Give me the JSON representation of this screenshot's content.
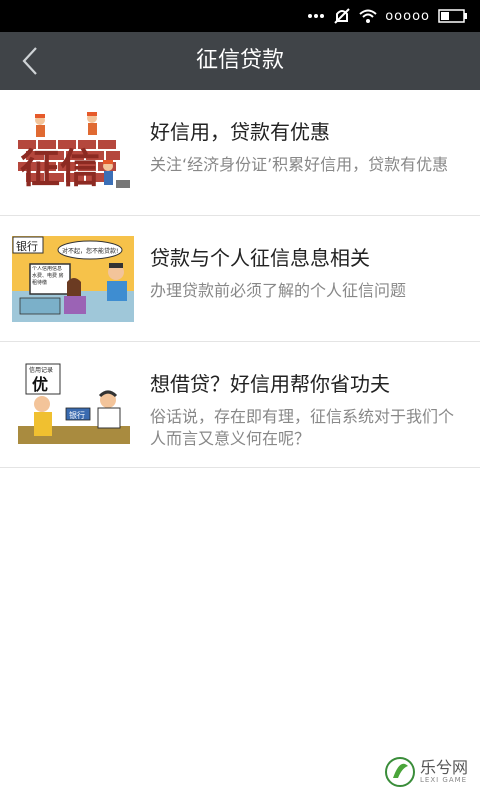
{
  "status_bar": {
    "carrier_dots": "ooooo",
    "icons": [
      "mute-icon",
      "wifi-icon",
      "signal-icon",
      "battery-icon"
    ]
  },
  "header": {
    "title": "征信贷款",
    "back_icon": "chevron-left-icon"
  },
  "items": [
    {
      "title": "好信用，贷款有优惠",
      "description": "关注‘经济身份证’积累好信用，贷款有优惠",
      "thumb_text": "征信"
    },
    {
      "title": "贷款与个人征信息息相关",
      "description": "办理贷款前必须了解的个人征信问题",
      "thumb_text": "银行",
      "thumb_bubble": "对不起，您不能贷款!",
      "thumb_screen": "个人信用信息 水费、电费 房租待缴"
    },
    {
      "title": "想借贷？好信用帮你省功夫",
      "description": "俗话说，存在即有理，征信系统对于我们个人而言又意义何在呢？",
      "thumb_text": "优",
      "thumb_card": "信用记录",
      "thumb_bank": "银行"
    }
  ],
  "watermark": {
    "text": "乐兮网",
    "subtext": "LEXI GAME"
  },
  "colors": {
    "appbar": "#404448",
    "statusbar": "#000000",
    "title_text": "#222222",
    "desc_text": "#888888"
  }
}
